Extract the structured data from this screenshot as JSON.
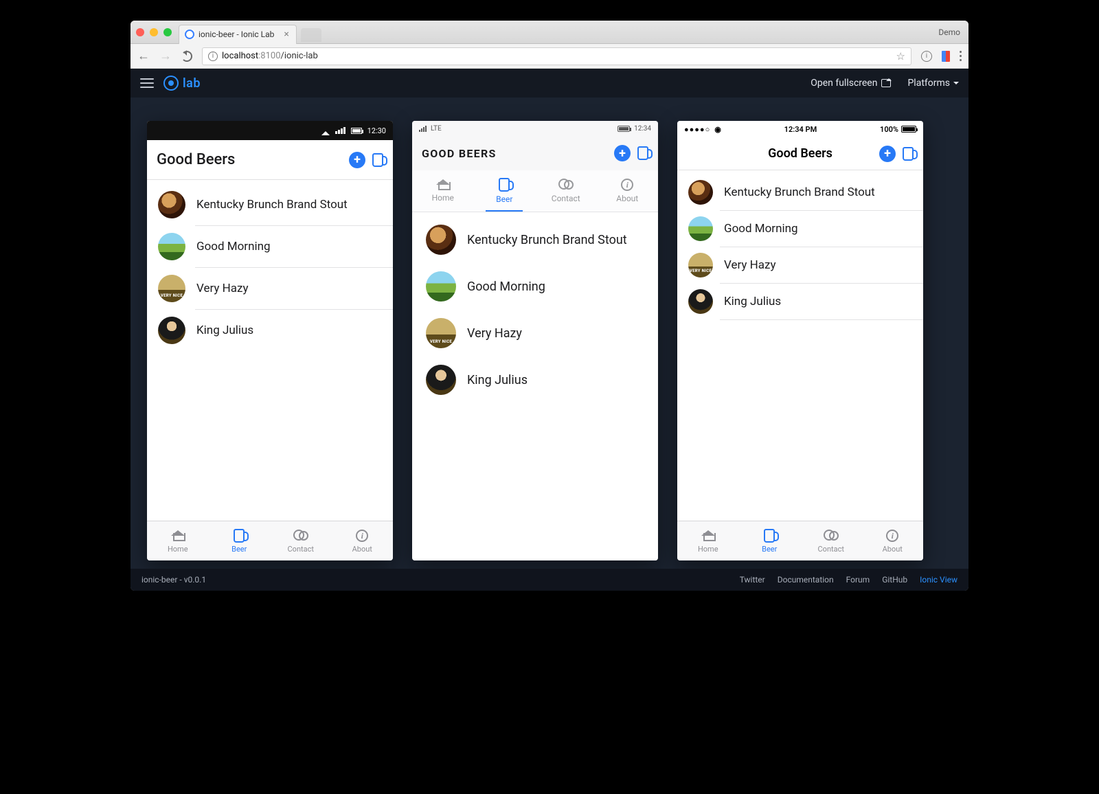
{
  "browser": {
    "tab_title": "ionic-beer - Ionic Lab",
    "demo_label": "Demo",
    "url_host": "localhost",
    "url_port": ":8100",
    "url_path": "/ionic-lab"
  },
  "lab": {
    "logo_text": "lab",
    "open_fullscreen": "Open fullscreen",
    "platforms": "Platforms",
    "footer_version": "ionic-beer - v0.0.1",
    "footer_links": {
      "twitter": "Twitter",
      "docs": "Documentation",
      "forum": "Forum",
      "github": "GitHub",
      "ionic_view": "Ionic View"
    }
  },
  "app": {
    "title": "Good Beers",
    "title_upper": "GOOD BEERS",
    "tabs": {
      "home": "Home",
      "beer": "Beer",
      "contact": "Contact",
      "about": "About"
    },
    "beers": [
      {
        "name": "Kentucky Brunch Brand Stout",
        "avatar": "av1"
      },
      {
        "name": "Good Morning",
        "avatar": "av2"
      },
      {
        "name": "Very Hazy",
        "avatar": "av3"
      },
      {
        "name": "King Julius",
        "avatar": "av4"
      }
    ]
  },
  "status": {
    "android_time": "12:30",
    "win_carrier": "LTE",
    "win_time": "12:34",
    "ios_time": "12:34 PM",
    "ios_battery": "100%"
  }
}
